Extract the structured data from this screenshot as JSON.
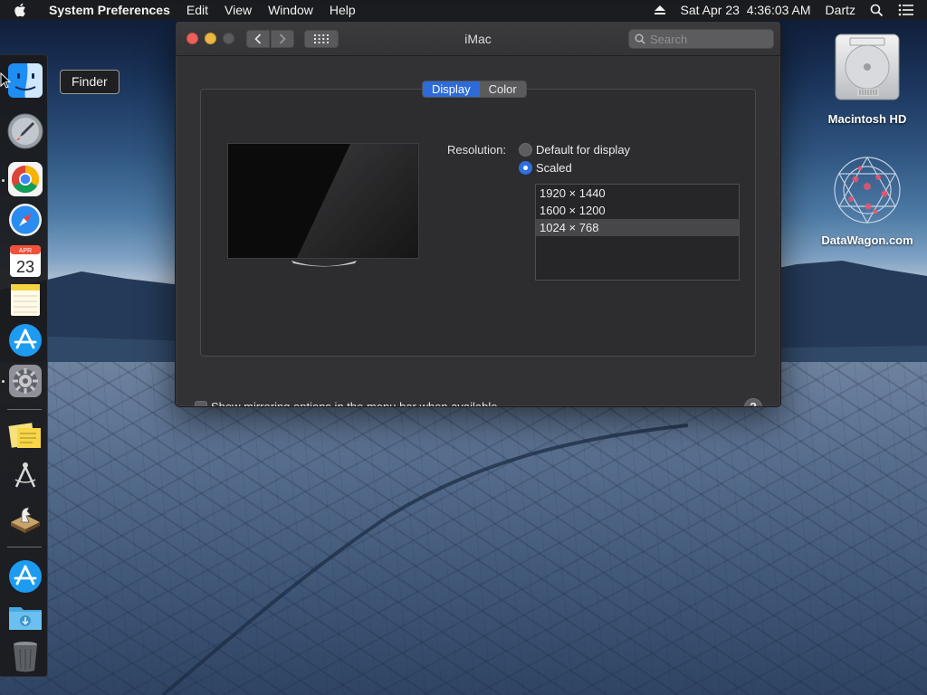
{
  "menubar": {
    "app_name": "System Preferences",
    "items": [
      "Edit",
      "View",
      "Window",
      "Help"
    ],
    "clock": "Sat Apr 23  4:36:03 AM",
    "user": "Dartz"
  },
  "dock": {
    "tooltip": "Finder",
    "calendar_month": "APR",
    "calendar_day": "23",
    "items": [
      "Finder",
      "Launchpad",
      "Google Chrome",
      "Safari",
      "Calendar",
      "Notes",
      "App Store",
      "System Preferences",
      "Stickies",
      "Unknown app",
      "Chess",
      "App Store",
      "Downloads",
      "Trash"
    ]
  },
  "desktop": {
    "hd_label": "Macintosh HD",
    "watermark_label": "DataWagon.com"
  },
  "window": {
    "title": "iMac",
    "search_placeholder": "Search",
    "tabs": [
      "Display",
      "Color"
    ],
    "active_tab": "Display",
    "resolution_label": "Resolution:",
    "options": [
      "Default for display",
      "Scaled"
    ],
    "selected_option": "Scaled",
    "resolutions": [
      "1920 × 1440",
      "1600 × 1200",
      "1024 × 768"
    ],
    "selected_resolution": "1024 × 768",
    "mirroring_label": "Show mirroring options in the menu bar when available",
    "mirroring_checked": false,
    "help_label": "?"
  },
  "colors": {
    "accent": "#2e6bd8",
    "window_bg": "#323234",
    "close": "#ec5f5a",
    "minimize": "#e9b843"
  }
}
